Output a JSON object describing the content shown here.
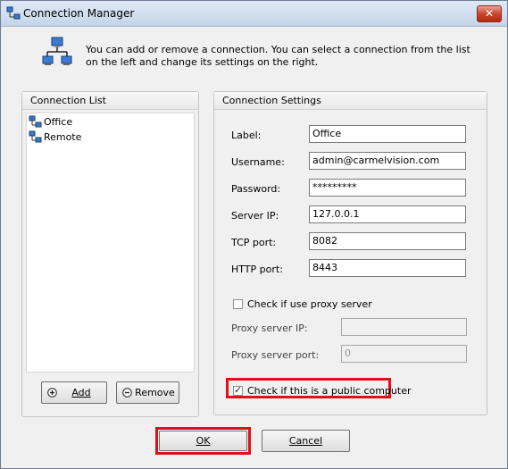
{
  "window": {
    "title": "Connection Manager",
    "close_glyph": "✕"
  },
  "banner": {
    "icon": "network-computers-icon",
    "text": "You can add or remove a connection.  You can select a connection from the list on the left and change its settings on the right."
  },
  "connection_list": {
    "header": "Connection List",
    "items": [
      {
        "label": "Office"
      },
      {
        "label": "Remote"
      }
    ],
    "add_label": "Add",
    "remove_label": "Remove"
  },
  "settings": {
    "header": "Connection Settings",
    "label_label": "Label:",
    "label_value": "Office",
    "username_label": "Username:",
    "username_value": "admin@carmelvision.com",
    "password_label": "Password:",
    "password_value": "*********",
    "server_ip_label": "Server IP:",
    "server_ip_value": "127.0.0.1",
    "tcp_port_label": "TCP port:",
    "tcp_port_value": "8082",
    "http_port_label": "HTTP port:",
    "http_port_value": "8443",
    "proxy_check_label": "Check if use proxy server",
    "proxy_checked": false,
    "proxy_ip_label": "Proxy server IP:",
    "proxy_ip_value": "",
    "proxy_port_label": "Proxy server port:",
    "proxy_port_value": "0",
    "public_check_label": "Check if this is a public computer",
    "public_checked": true
  },
  "footer": {
    "ok_label": "OK",
    "cancel_label": "Cancel"
  },
  "colors": {
    "highlight": "#e0101a",
    "title_bar": "#c4d5ea",
    "dialog_bg": "#f0f0f0"
  }
}
